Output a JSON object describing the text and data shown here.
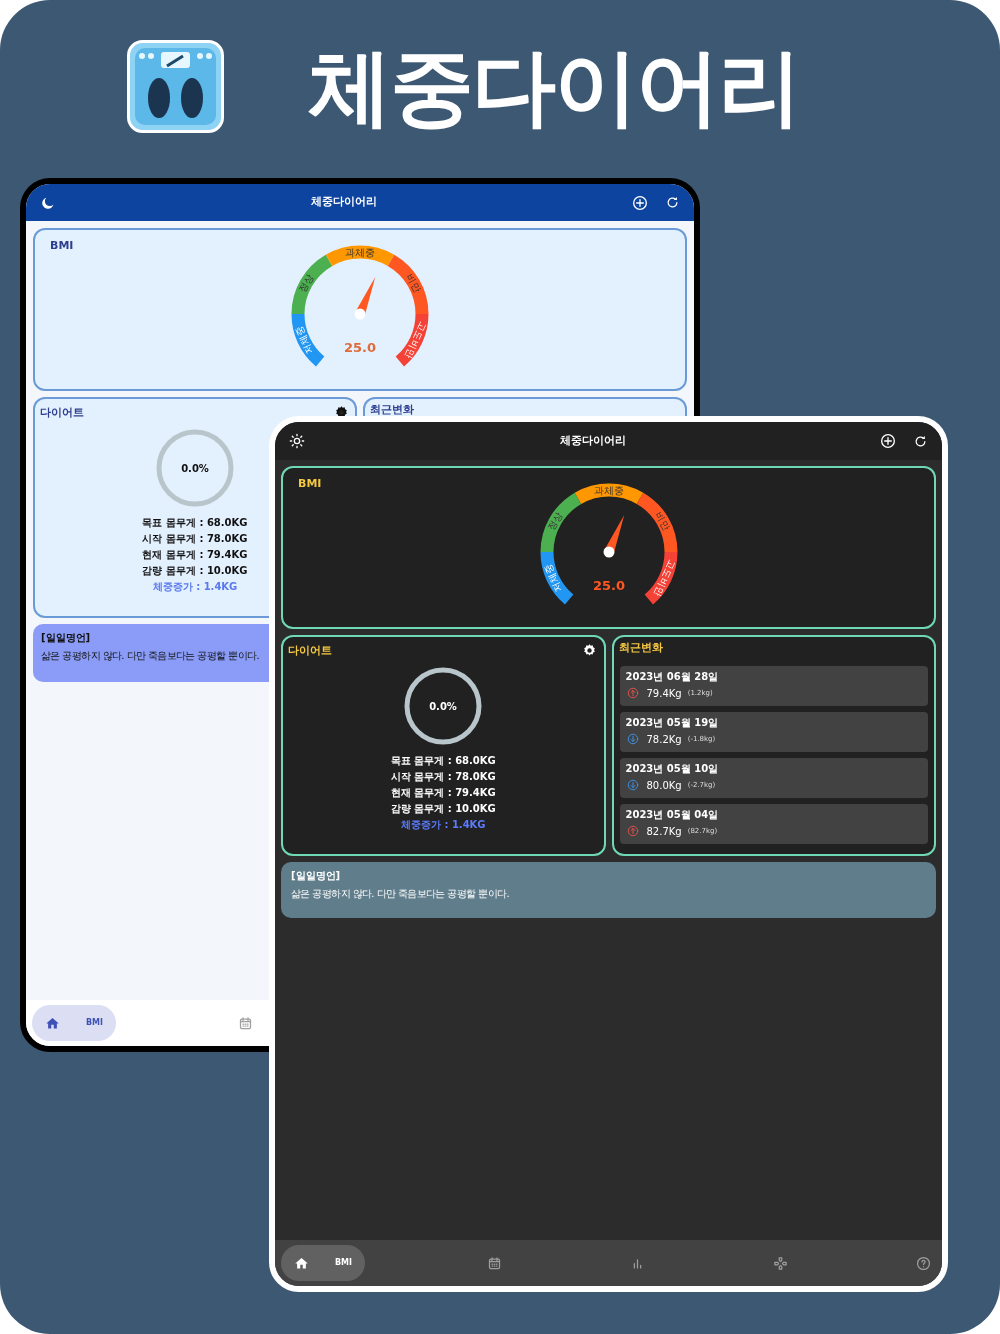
{
  "banner": {
    "title": "체중다이어리"
  },
  "tablets": [
    {
      "dark_mode": false,
      "toolbar": {
        "title": "체중다이어리"
      },
      "bmi": {
        "title": "BMI",
        "value": "25.0",
        "level": 0.58,
        "segments": [
          {
            "label": "저체중",
            "color": "#2196f3"
          },
          {
            "label": "정상",
            "color": "#4caf50"
          },
          {
            "label": "과체중",
            "color": "#ff9800"
          },
          {
            "label": "비만",
            "color": "#ff5722"
          },
          {
            "label": "고도비만",
            "color": "#f44336"
          }
        ]
      },
      "diet": {
        "title": "다이어트",
        "progress": "0.0%",
        "level": 0,
        "lines": [
          "목표 몸무게 : 68.0KG",
          "시작 몸무게 : 78.0KG",
          "현재 몸무게 : 79.4KG",
          "감량 몸무게 : 10.0KG"
        ],
        "gain": "체중증가 : 1.4KG"
      },
      "recent": {
        "title": "최근변화"
      },
      "quote": {
        "title": "[일일명언]",
        "text": "삶은 공평하지 않다. 다만 죽음보다는 공평할 뿐이다."
      },
      "nav": [
        {
          "kind": "home",
          "label": "BMI",
          "selected": true
        },
        {
          "kind": "calendar",
          "selected": false
        }
      ]
    },
    {
      "dark_mode": true,
      "toolbar": {
        "title": "체중다이어리"
      },
      "bmi": {
        "title": "BMI",
        "value": "25.0",
        "level": 0.58,
        "segments": [
          {
            "label": "저체중",
            "color": "#2196f3"
          },
          {
            "label": "정상",
            "color": "#4caf50"
          },
          {
            "label": "과체중",
            "color": "#ff9800"
          },
          {
            "label": "비만",
            "color": "#ff5722"
          },
          {
            "label": "고도비만",
            "color": "#f44336"
          }
        ]
      },
      "diet": {
        "title": "다이어트",
        "progress": "0.0%",
        "level": 0,
        "lines": [
          "목표 몸무게 : 68.0KG",
          "시작 몸무게 : 78.0KG",
          "현재 몸무게 : 79.4KG",
          "감량 몸무게 : 10.0KG"
        ],
        "gain": "체중증가 : 1.4KG"
      },
      "recent": {
        "title": "최근변화",
        "items": [
          {
            "date": "2023년 06월 28일",
            "weight": "79.4Kg",
            "delta": "(1.2kg)",
            "kind": "up"
          },
          {
            "date": "2023년 05월 19일",
            "weight": "78.2Kg",
            "delta": "(-1.8kg)",
            "kind": "down"
          },
          {
            "date": "2023년 05월 10일",
            "weight": "80.0Kg",
            "delta": "(-2.7kg)",
            "kind": "down"
          },
          {
            "date": "2023년 05월 04일",
            "weight": "82.7Kg",
            "delta": "(82.7kg)",
            "kind": "up"
          }
        ]
      },
      "quote": {
        "title": "[일일명언]",
        "text": "삶은 공평하지 않다. 다만 죽음보다는 공평할 뿐이다."
      },
      "nav": [
        {
          "kind": "home",
          "label": "BMI",
          "selected": true
        },
        {
          "kind": "calendar",
          "selected": false
        },
        {
          "kind": "chart",
          "selected": false
        },
        {
          "kind": "gamepad",
          "selected": false
        },
        {
          "kind": "help",
          "selected": false
        }
      ]
    }
  ]
}
